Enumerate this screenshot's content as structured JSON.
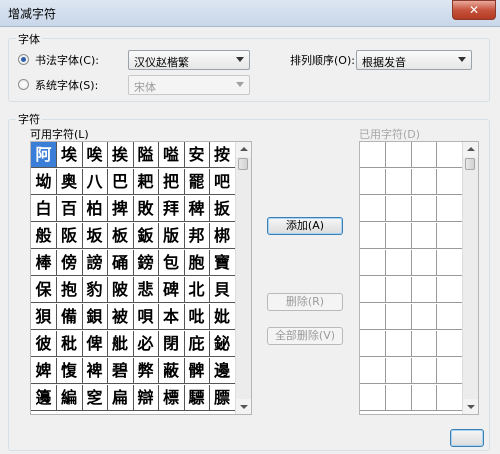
{
  "window": {
    "title": "增减字符",
    "close_glyph": "✕"
  },
  "font_group": {
    "label": "字体",
    "calligraphy": {
      "label": "书法字体(C):",
      "selected": true,
      "value": "汉仪赵楷繁"
    },
    "system": {
      "label": "系统字体(S):",
      "selected": false,
      "value": "宋体"
    },
    "sort": {
      "label": "排列顺序(O):",
      "value": "根据发音"
    }
  },
  "char_group": {
    "label": "字符",
    "available_label": "可用字符(L)",
    "used_label": "已用字符(D)",
    "rows": [
      [
        "阿",
        "埃",
        "唉",
        "挨",
        "隘",
        "嗌",
        "安",
        "按"
      ],
      [
        "坳",
        "奥",
        "八",
        "巴",
        "耙",
        "把",
        "罷",
        "吧"
      ],
      [
        "白",
        "百",
        "柏",
        "捭",
        "敗",
        "拜",
        "稗",
        "扳"
      ],
      [
        "般",
        "阪",
        "坂",
        "板",
        "鈑",
        "版",
        "邦",
        "梆"
      ],
      [
        "棒",
        "傍",
        "謗",
        "硧",
        "鎊",
        "包",
        "胞",
        "寶"
      ],
      [
        "保",
        "抱",
        "豹",
        "陂",
        "悲",
        "碑",
        "北",
        "貝"
      ],
      [
        "狽",
        "備",
        "鋇",
        "被",
        "唄",
        "本",
        "吡",
        "妣"
      ],
      [
        "彼",
        "秕",
        "俾",
        "舭",
        "必",
        "閉",
        "庇",
        "鉍"
      ],
      [
        "婢",
        "愎",
        "裨",
        "碧",
        "弊",
        "蔽",
        "髀",
        "邊"
      ],
      [
        "籩",
        "編",
        "窆",
        "扁",
        "辯",
        "標",
        "驃",
        "膘"
      ]
    ],
    "selected_char": "阿"
  },
  "buttons": {
    "add": "添加(A)",
    "delete": "删除(R)",
    "delete_all": "全部删除(V)"
  }
}
